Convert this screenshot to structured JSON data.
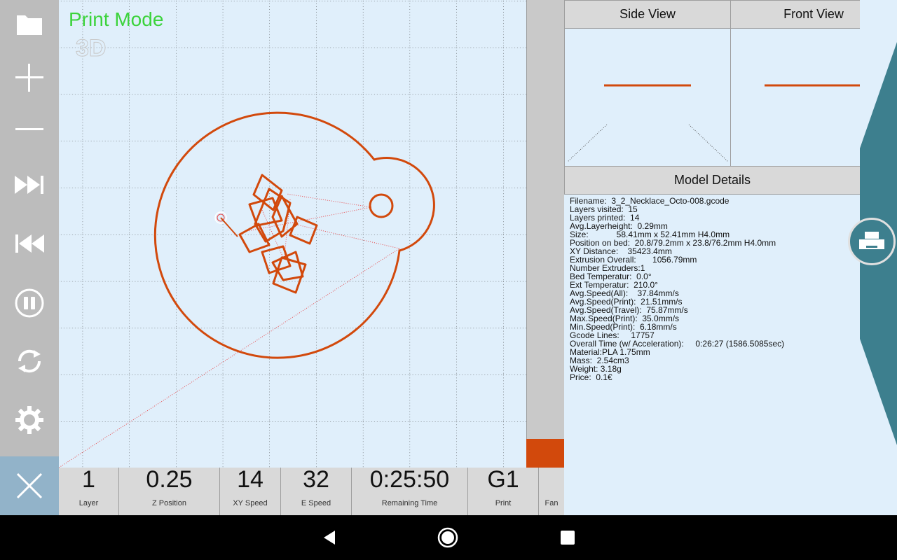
{
  "toolbar": {
    "items": [
      {
        "name": "open-folder",
        "icon": "folder-icon"
      },
      {
        "name": "zoom-in",
        "icon": "plus-icon"
      },
      {
        "name": "zoom-out",
        "icon": "minus-icon"
      },
      {
        "name": "fast-forward",
        "icon": "fast-forward-icon"
      },
      {
        "name": "rewind",
        "icon": "rewind-icon"
      },
      {
        "name": "pause",
        "icon": "pause-icon"
      },
      {
        "name": "refresh",
        "icon": "refresh-icon"
      },
      {
        "name": "settings",
        "icon": "gear-icon"
      }
    ],
    "close_icon": "close-icon"
  },
  "canvas": {
    "mode_label": "Print Mode",
    "view_toggle": "3D",
    "layer_progress": 0.06
  },
  "status": [
    {
      "value": "1",
      "label": "Layer"
    },
    {
      "value": "0.25",
      "label": "Z Position"
    },
    {
      "value": "14",
      "label": "XY Speed"
    },
    {
      "value": "32",
      "label": "E Speed"
    },
    {
      "value": "0:25:50",
      "label": "Remaining Time"
    },
    {
      "value": "G1",
      "label": "Print"
    },
    {
      "value": "",
      "label": "Fan"
    }
  ],
  "views": {
    "side_title": "Side View",
    "front_title": "Front View"
  },
  "details": {
    "title": "Model Details",
    "lines": [
      "Filename:  3_2_Necklace_Octo-008.gcode",
      "Layers visited:  15",
      "Layers printed:  14",
      "Avg.Layerheight:  0.29mm",
      "Size:            58.41mm x 52.41mm H4.0mm",
      "Position on bed:  20.8/79.2mm x 23.8/76.2mm H4.0mm",
      "XY Distance:    35423.4mm",
      "Extrusion Overall:       1056.79mm",
      "Number Extruders:1",
      "Bed Temperatur:  0.0°",
      "Ext Temperatur:  210.0°",
      "Avg.Speed(All):    37.84mm/s",
      "Avg.Speed(Print):  21.51mm/s",
      "Avg.Speed(Travel):  75.87mm/s",
      "Max.Speed(Print):  35.0mm/s",
      "Min.Speed(Print):  6.18mm/s",
      "Gcode Lines:     17757",
      "Overall Time (w/ Acceleration):     0:26:27 (1586.5085sec)",
      "Material:PLA 1.75mm",
      "Mass:  2.54cm3",
      "Weight: 3.18g",
      "Price:  0.1€"
    ]
  },
  "print_button": {
    "icon": "printer-icon"
  },
  "navbar": {
    "back_icon": "back-triangle-icon",
    "home_icon": "home-circle-icon",
    "recents_icon": "recents-square-icon"
  },
  "colors": {
    "accent": "#d2490c",
    "mode_label": "#3cd33c",
    "teal": "#3d7f8e",
    "background": "#e0effb"
  }
}
